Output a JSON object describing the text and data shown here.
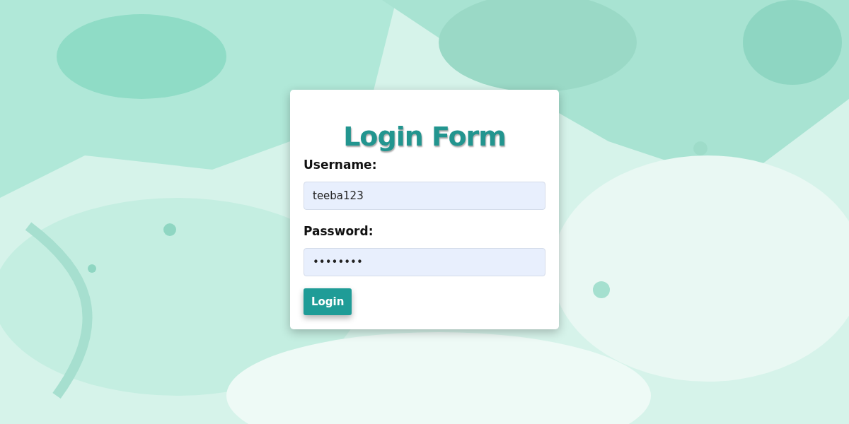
{
  "form": {
    "title": "Login Form",
    "fields": [
      {
        "label": "Username:",
        "value": "teeba123"
      },
      {
        "label": "Password:",
        "value": "••••••••"
      }
    ],
    "button": "Login"
  }
}
